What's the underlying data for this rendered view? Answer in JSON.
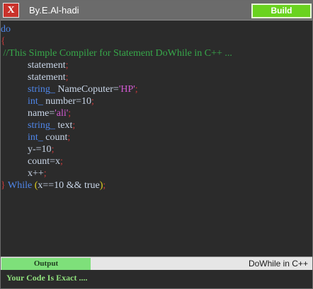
{
  "titlebar": {
    "close_label": "X",
    "author": "By.E.Al-hadi",
    "build_label": "Build"
  },
  "editor": {
    "lines": [
      {
        "indent": 0,
        "tokens": [
          {
            "t": "do",
            "c": "kw"
          }
        ]
      },
      {
        "indent": 0,
        "tokens": [
          {
            "t": "{",
            "c": "brace-open"
          }
        ]
      },
      {
        "indent": 0,
        "tokens": [
          {
            "t": " //This Simple Compiler for Statement DoWhile in C++ ...",
            "c": "cm"
          }
        ]
      },
      {
        "indent": 1,
        "tokens": [
          {
            "t": "statement",
            "c": "id"
          },
          {
            "t": ";",
            "c": "semi"
          }
        ]
      },
      {
        "indent": 1,
        "tokens": [
          {
            "t": "statement",
            "c": "id"
          },
          {
            "t": ";",
            "c": "semi"
          }
        ]
      },
      {
        "indent": 1,
        "tokens": [
          {
            "t": "string_",
            "c": "kw"
          },
          {
            "t": " NameCoputer=",
            "c": "id"
          },
          {
            "t": "'HP'",
            "c": "str"
          },
          {
            "t": ";",
            "c": "semi"
          }
        ]
      },
      {
        "indent": 1,
        "tokens": [
          {
            "t": "int_",
            "c": "kw"
          },
          {
            "t": " number=10",
            "c": "id"
          },
          {
            "t": ";",
            "c": "semi"
          }
        ]
      },
      {
        "indent": 1,
        "tokens": [
          {
            "t": "name=",
            "c": "id"
          },
          {
            "t": "'ali'",
            "c": "str"
          },
          {
            "t": ";",
            "c": "semi"
          }
        ]
      },
      {
        "indent": 1,
        "tokens": [
          {
            "t": "string_",
            "c": "kw"
          },
          {
            "t": " text",
            "c": "id"
          },
          {
            "t": ";",
            "c": "semi"
          }
        ]
      },
      {
        "indent": 1,
        "tokens": [
          {
            "t": "int_",
            "c": "kw"
          },
          {
            "t": " count",
            "c": "id"
          },
          {
            "t": ";",
            "c": "semi"
          }
        ]
      },
      {
        "indent": 1,
        "tokens": [
          {
            "t": "y-=10",
            "c": "id"
          },
          {
            "t": ";",
            "c": "semi"
          }
        ]
      },
      {
        "indent": 1,
        "tokens": [
          {
            "t": "count=x",
            "c": "id"
          },
          {
            "t": ";",
            "c": "semi"
          }
        ]
      },
      {
        "indent": 1,
        "tokens": [
          {
            "t": "x++",
            "c": "id"
          },
          {
            "t": ";",
            "c": "semi"
          }
        ]
      },
      {
        "indent": 0,
        "tokens": [
          {
            "t": "}",
            "c": "brace-close"
          },
          {
            "t": " While ",
            "c": "blue"
          },
          {
            "t": "(",
            "c": "paren"
          },
          {
            "t": "x==10 && true",
            "c": "id"
          },
          {
            "t": ")",
            "c": "paren"
          },
          {
            "t": ";",
            "c": "semi"
          }
        ]
      }
    ]
  },
  "statusbar": {
    "output_label": "Output",
    "mode": "DoWhile in C++"
  },
  "output": {
    "message": "Your Code Is Exact ...."
  }
}
